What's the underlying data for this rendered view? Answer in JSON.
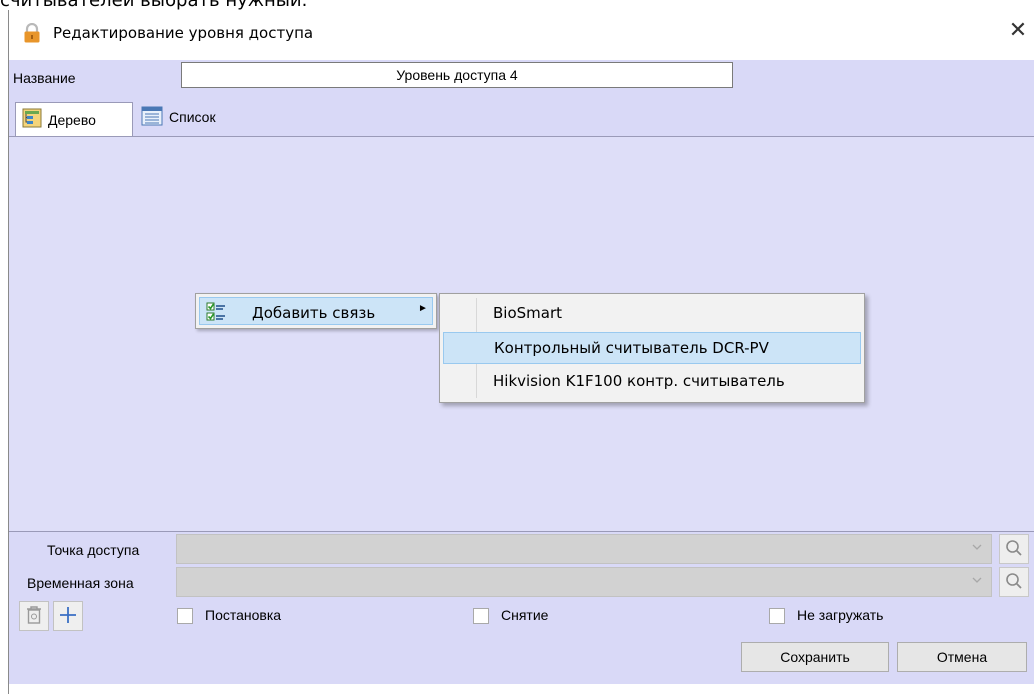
{
  "caption_fragment": "считывателей выбрать нужный.",
  "window": {
    "title": "Редактирование уровня доступа",
    "close_glyph": "✕"
  },
  "name_field": {
    "label": "Название",
    "value": "Уровень доступа 4"
  },
  "tabs": [
    {
      "label": "Дерево",
      "icon": "tree-view-icon",
      "active": true
    },
    {
      "label": "Список",
      "icon": "list-view-icon",
      "active": false
    }
  ],
  "context_menu": {
    "item_label": "Добавить связь",
    "item_icon": "add-link-icon",
    "submenu_arrow": "►"
  },
  "submenu": {
    "items": [
      {
        "label": "BioSmart",
        "highlighted": false
      },
      {
        "label": "Контрольный считыватель DCR-PV",
        "highlighted": true
      },
      {
        "label": "Hikvision K1F100 контр. считыватель",
        "highlighted": false
      }
    ]
  },
  "fields": {
    "access_point_label": "Точка доступа",
    "time_zone_label": "Временная зона"
  },
  "checkboxes": [
    {
      "label": "Постановка",
      "checked": false
    },
    {
      "label": "Снятие",
      "checked": false
    },
    {
      "label": "Не загружать",
      "checked": false
    }
  ],
  "buttons": {
    "save": "Сохранить",
    "cancel": "Отмена"
  },
  "colors": {
    "panel_lilac": "#d9d9f7",
    "tree_background": "#dedef8",
    "menu_highlight": "#cce4f7",
    "lock_icon_orange": "#e8952a"
  }
}
